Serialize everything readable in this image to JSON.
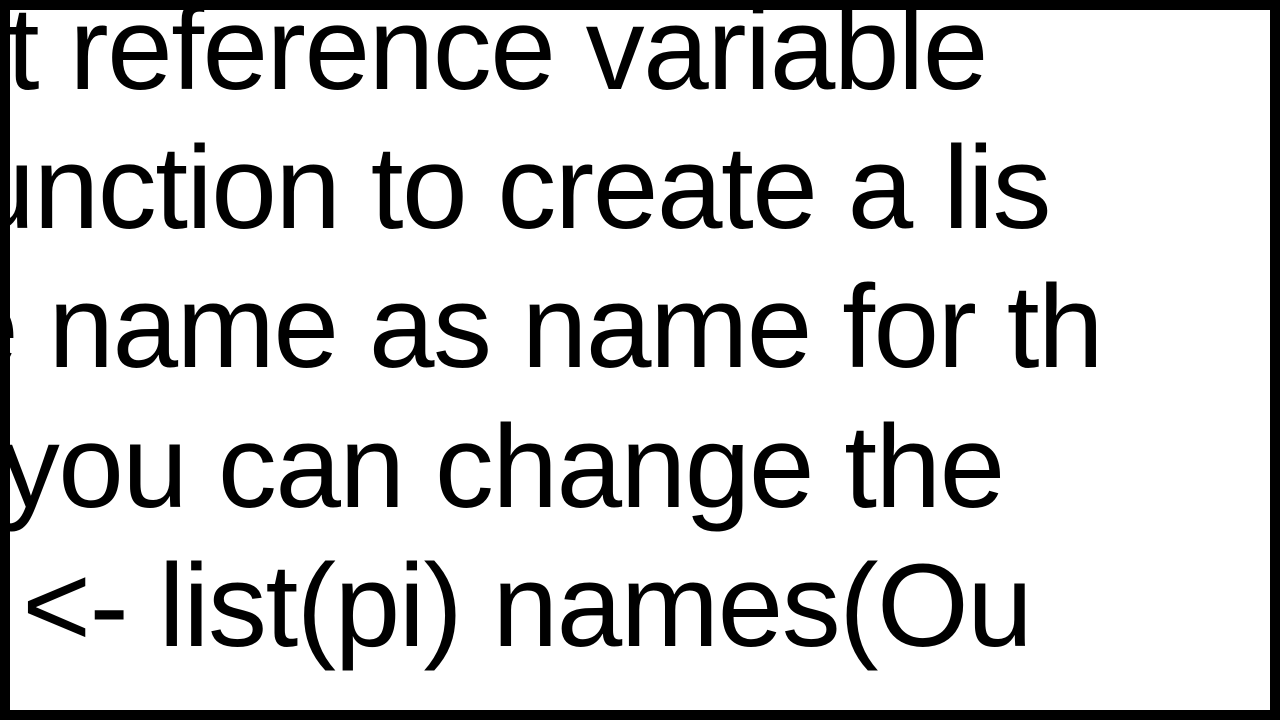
{
  "lines": {
    "l1": " can't reference variable",
    "l2": "t() function to create a lis",
    "l3": "able name as name for th",
    "l4": " list, you can change the",
    "l5": "tput <- list(pi) names(Ou"
  }
}
